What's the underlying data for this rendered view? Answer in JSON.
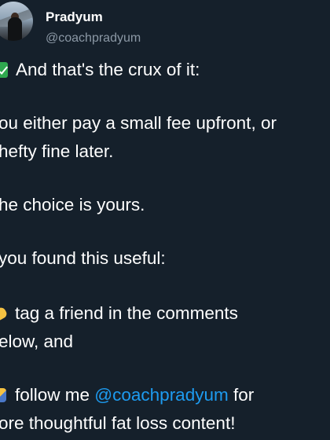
{
  "author": {
    "name": "Pradyum",
    "handle": "@coachpradyum"
  },
  "tweet": {
    "line1": "And that's the crux of it:",
    "line2": "ou either pay a small fee upfront, or",
    "line3": "hefty fine later.",
    "line4": "he choice is yours.",
    "line5": "you found this useful:",
    "line6": "tag a friend in the comments",
    "line7": "elow, and",
    "line8_prefix": "follow me ",
    "line8_mention": "@coachpradyum",
    "line8_suffix": " for",
    "line9": "ore thoughtful fat loss content!"
  },
  "icons": {
    "check": "check-mark-button-emoji",
    "point": "backhand-index-pointing-right-emoji",
    "write": "writing-hand-emoji"
  },
  "colors": {
    "background": "#15202b",
    "text": "#ffffff",
    "secondary": "#8b98a5",
    "mention": "#1d9bf0"
  }
}
